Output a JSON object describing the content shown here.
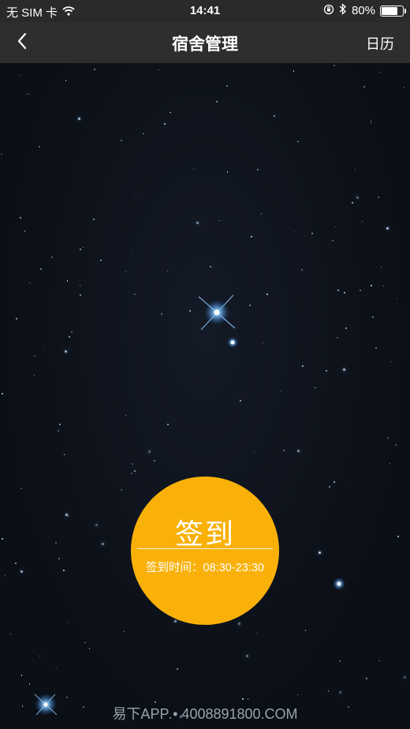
{
  "status_bar": {
    "carrier": "无 SIM 卡",
    "time": "14:41",
    "battery": "80%",
    "battery_level": 0.8,
    "icons": [
      "wifi-icon",
      "orientation-lock-icon",
      "bluetooth-icon",
      "battery-icon"
    ]
  },
  "nav": {
    "back_icon": "chevron-left-icon",
    "title": "宿舍管理",
    "right_label": "日历"
  },
  "checkin": {
    "label": "签到",
    "time_text": "签到时间：08:30-23:30",
    "color": "#f9b10a"
  },
  "footer": {
    "text": "易下APP • 4008891800.COM"
  },
  "colors": {
    "nav_bg": "#2e2e2e",
    "background": "#0b0f16",
    "accent": "#f9b10a"
  }
}
